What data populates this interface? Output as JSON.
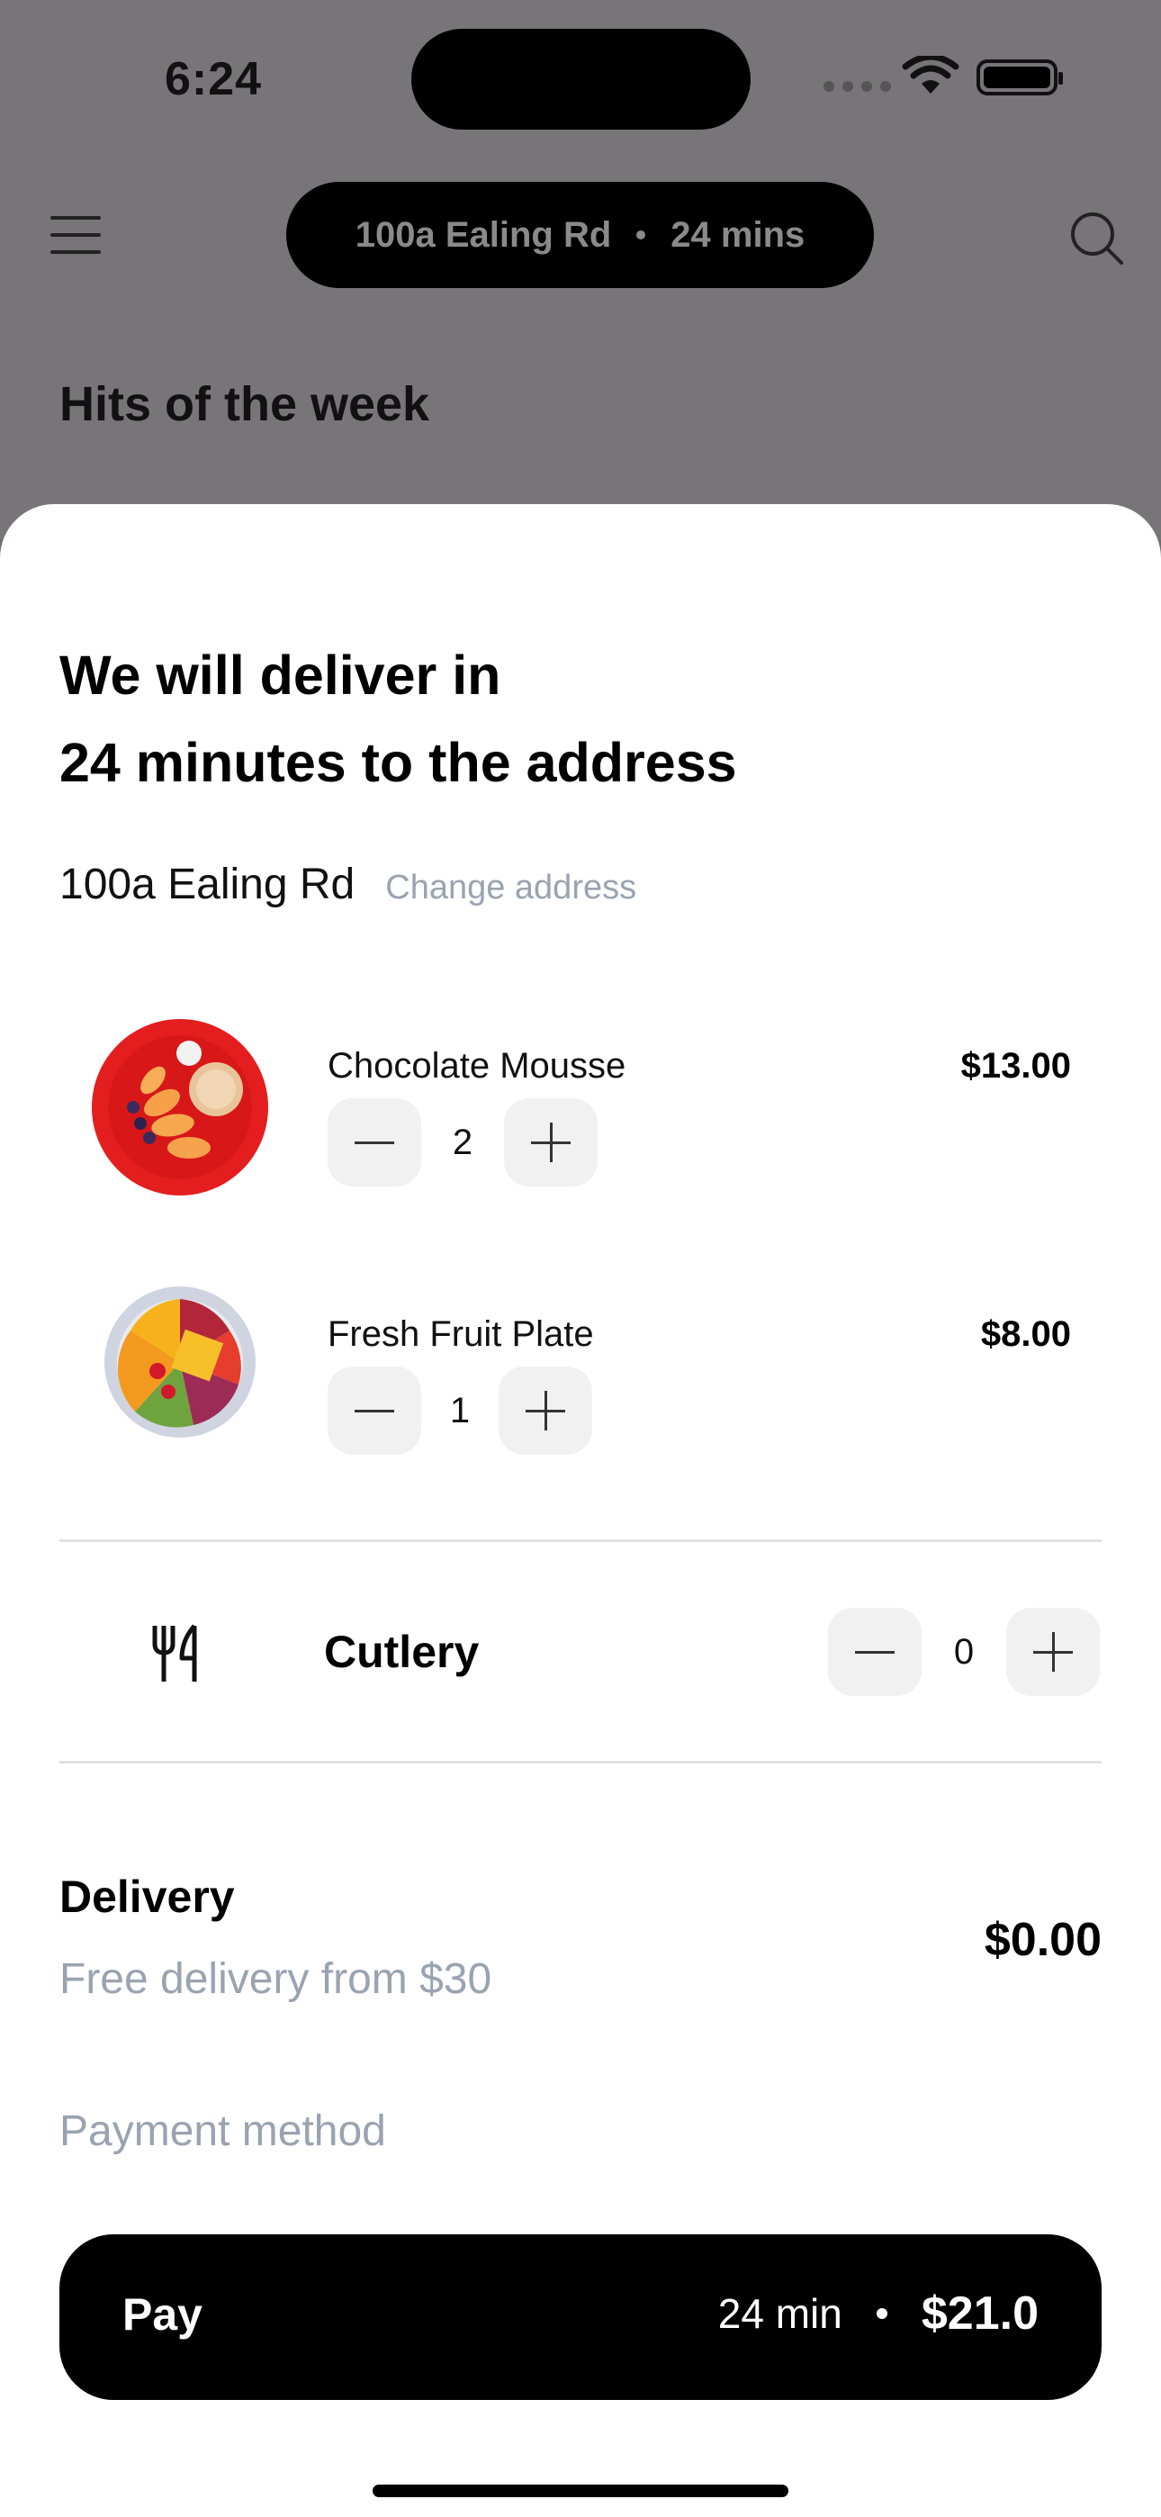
{
  "status_bar": {
    "time": "6:24"
  },
  "header": {
    "address": "100a Ealing Rd",
    "eta": "24 mins"
  },
  "background": {
    "section_title": "Hits of the week"
  },
  "sheet": {
    "title_line1": "We will deliver in",
    "title_line2": "24 minutes to the address",
    "address": "100a Ealing Rd",
    "change_address": "Change address",
    "items": [
      {
        "name": "Chocolate Mousse",
        "price": "$13.00",
        "quantity": "2"
      },
      {
        "name": "Fresh Fruit Plate",
        "price": "$8.00",
        "quantity": "1"
      }
    ],
    "cutlery": {
      "label": "Cutlery",
      "quantity": "0"
    },
    "delivery": {
      "title": "Delivery",
      "subtitle": "Free delivery from $30",
      "price": "$0.00"
    },
    "payment": {
      "title": "Payment method"
    },
    "pay": {
      "label": "Pay",
      "time": "24 min",
      "total": "$21.0"
    }
  },
  "colors": {
    "accent": "#000000",
    "muted_text": "#9aa3b0",
    "stepper_bg": "#f1f1f2",
    "dim_overlay": "#787579"
  },
  "icons": [
    "menu-icon",
    "search-icon",
    "wifi-icon",
    "battery-icon",
    "minus-icon",
    "plus-icon",
    "cutlery-icon",
    "chevron-right-icon"
  ]
}
